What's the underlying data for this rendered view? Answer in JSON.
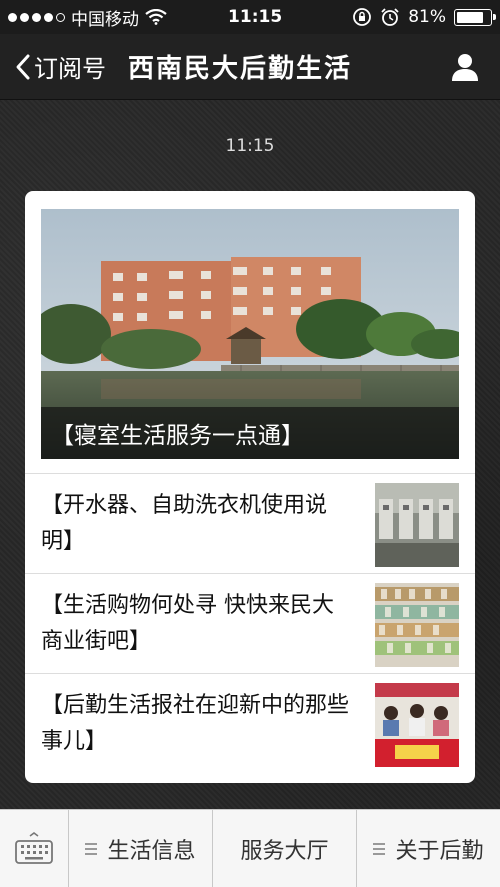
{
  "status_bar": {
    "carrier": "中国移动",
    "time": "11:15",
    "battery": "81%",
    "battery_level": 0.81
  },
  "nav": {
    "back_label": "订阅号",
    "title": "西南民大后勤生活"
  },
  "chat": {
    "timestamp": "11:15",
    "cover_title": "【寝室生活服务一点通】",
    "articles": [
      {
        "title": "【开水器、自助洗衣机使用说明】"
      },
      {
        "title": "【生活购物何处寻 快快来民大商业街吧】"
      },
      {
        "title": "【后勤生活报社在迎新中的那些事儿】"
      }
    ]
  },
  "menu": {
    "items": [
      {
        "label": "生活信息"
      },
      {
        "label": "服务大厅"
      },
      {
        "label": "关于后勤"
      }
    ]
  },
  "icons": {
    "wifi": "wifi-icon",
    "rotation_lock": "rotation-lock-icon",
    "alarm": "alarm-icon",
    "back": "chevron-left-icon",
    "profile": "person-icon",
    "keyboard": "keyboard-icon",
    "menu": "menu-lines-icon"
  }
}
